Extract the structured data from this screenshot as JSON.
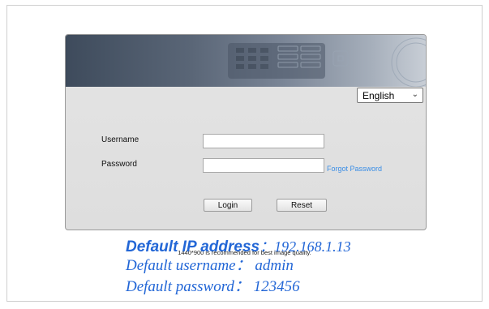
{
  "login": {
    "language": "English",
    "username_label": "Username",
    "password_label": "Password",
    "username_value": "",
    "password_value": "",
    "forgot_password": "Forgot Password",
    "login_button": "Login",
    "reset_button": "Reset"
  },
  "footer": {
    "resolution_note": "1440*900 is recommended for best image quality."
  },
  "overlay": {
    "ip_label": "Default IP address",
    "ip_sep": "：",
    "ip_value": "192.168.1.13",
    "username_line": "Default username： admin",
    "password_line": "Default password： 123456"
  },
  "colors": {
    "accent": "#2266d6",
    "link": "#3a8ee6"
  }
}
